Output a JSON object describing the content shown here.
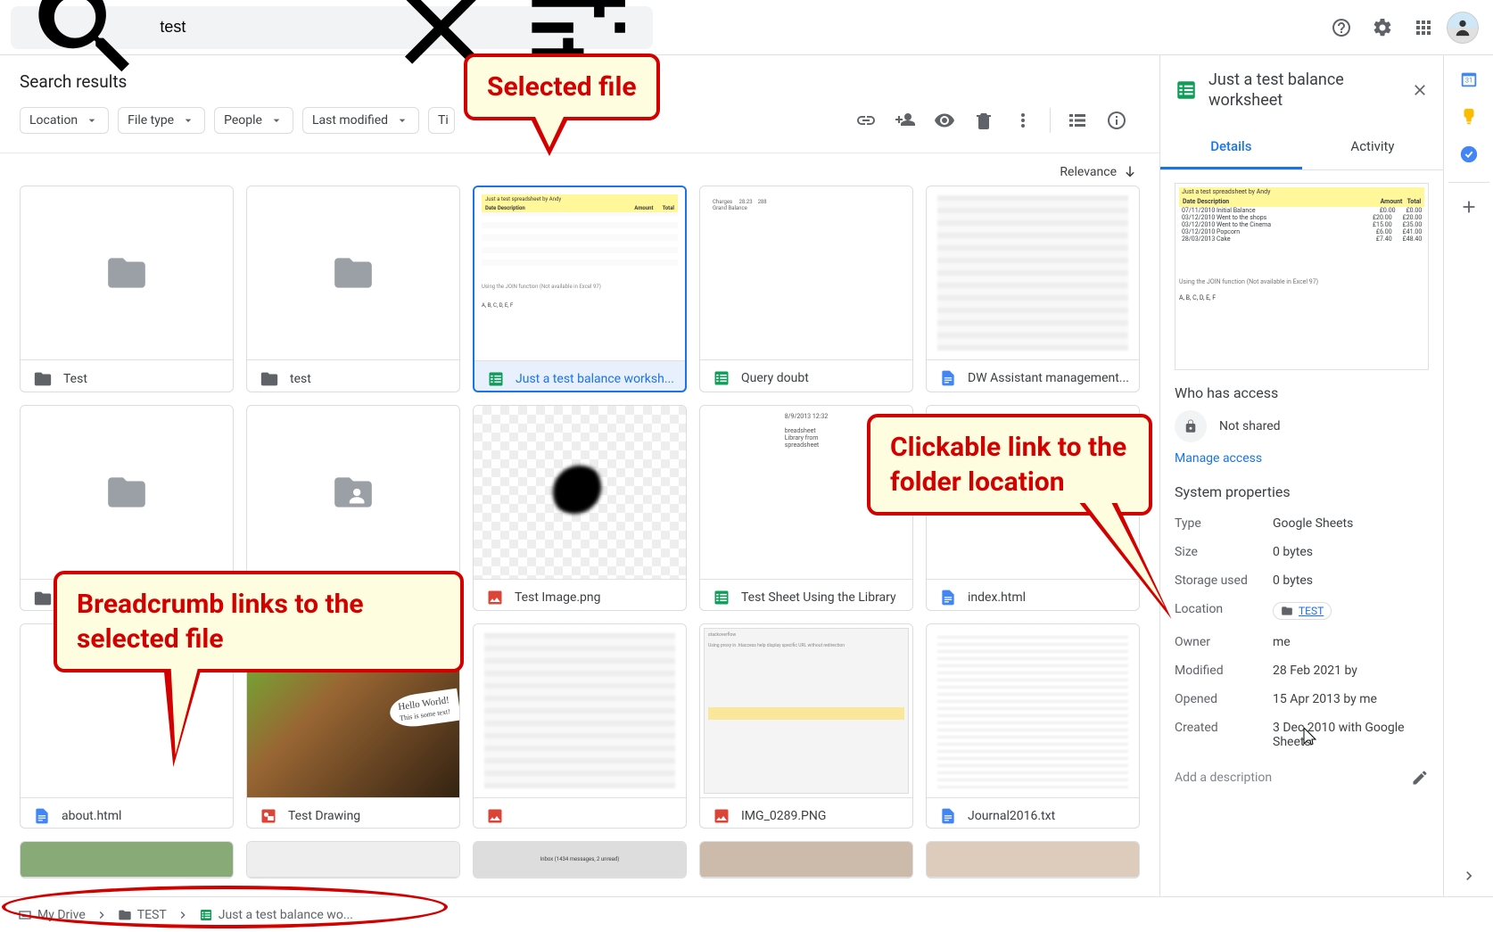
{
  "search": {
    "value": "test"
  },
  "heading": "Search results",
  "chips": [
    "Location",
    "File type",
    "People",
    "Last modified",
    "Ti"
  ],
  "sort": "Relevance",
  "tiles": [
    {
      "name": "Test",
      "type": "folder"
    },
    {
      "name": "test",
      "type": "folder"
    },
    {
      "name": "Just a test balance worksh...",
      "type": "sheets",
      "selected": true
    },
    {
      "name": "Query doubt",
      "type": "sheets"
    },
    {
      "name": "DW Assistant management...",
      "type": "docs"
    },
    {
      "name": "",
      "type": "folder"
    },
    {
      "name": "",
      "type": "folder-shared"
    },
    {
      "name": "Test Image.png",
      "type": "image"
    },
    {
      "name": "Test Sheet Using the Library",
      "type": "sheets"
    },
    {
      "name": "index.html",
      "type": "docs"
    },
    {
      "name": "about.html",
      "type": "docs"
    },
    {
      "name": "Test Drawing",
      "type": "drawing"
    },
    {
      "name": "",
      "type": "image"
    },
    {
      "name": "IMG_0289.PNG",
      "type": "image"
    },
    {
      "name": "Journal2016.txt",
      "type": "docs"
    }
  ],
  "panel": {
    "title": "Just a test balance worksheet",
    "tabs": {
      "details": "Details",
      "activity": "Activity"
    },
    "access_heading": "Who has access",
    "not_shared": "Not shared",
    "manage": "Manage access",
    "props_heading": "System properties",
    "props": {
      "type_k": "Type",
      "type_v": "Google Sheets",
      "size_k": "Size",
      "size_v": "0 bytes",
      "storage_k": "Storage used",
      "storage_v": "0 bytes",
      "location_k": "Location",
      "location_v": "TEST",
      "owner_k": "Owner",
      "owner_v": "me",
      "modified_k": "Modified",
      "modified_v": "28 Feb 2021 by",
      "opened_k": "Opened",
      "opened_v": "15 Apr 2013 by me",
      "created_k": "Created",
      "created_v": "3 Dec 2010 with Google Sheets"
    },
    "desc_placeholder": "Add a description"
  },
  "breadcrumb": {
    "a": "My Drive",
    "b": "TEST",
    "c": "Just a test balance wo..."
  },
  "callouts": {
    "c1": "Selected file",
    "c2": "Breadcrumb links to the selected file",
    "c3": "Clickable link to the folder location"
  },
  "preview": {
    "title": "Just a test spreadsheet by Andy",
    "h_date": "Date",
    "h_desc": "Description",
    "h_amt": "Amount",
    "h_total": "Total",
    "rows": [
      [
        "07/11/2010",
        "Initial Balance",
        "£0.00",
        "£0.00"
      ],
      [
        "03/12/2010",
        "Went to the shops",
        "£20.00",
        "£20.00"
      ],
      [
        "03/12/2010",
        "Went to the Cinema",
        "£15.00",
        "£35.00"
      ],
      [
        "03/12/2010",
        "Popcorn",
        "£6.00",
        "£41.00"
      ],
      [
        "28/03/2013",
        "Cake",
        "£7.40",
        "£48.40"
      ]
    ],
    "note": "Using the JOIN function (Not available in Excel 97)",
    "abc": "A, B, C, D, E, F"
  }
}
